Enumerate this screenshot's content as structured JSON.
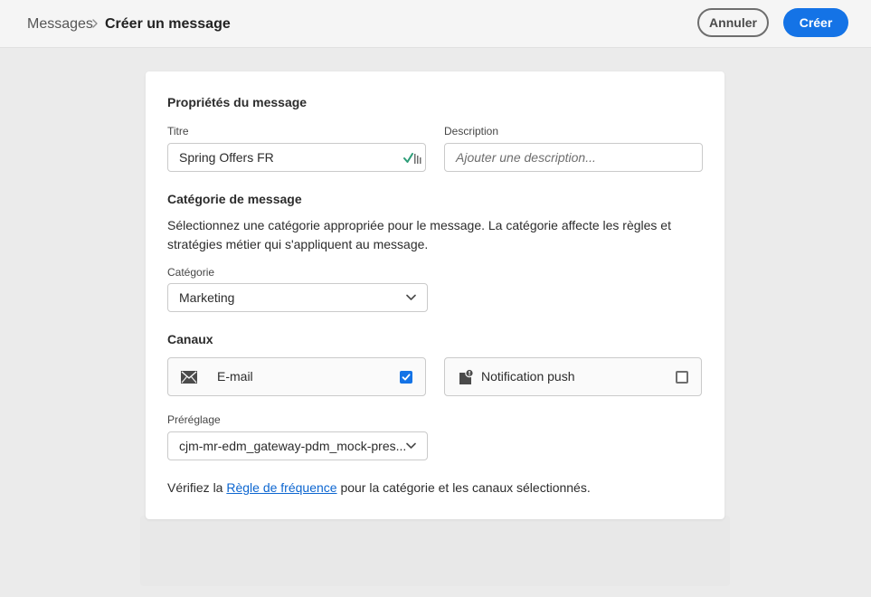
{
  "header": {
    "breadcrumb_root": "Messages",
    "breadcrumb_current": "Créer un message",
    "cancel_label": "Annuler",
    "create_label": "Créer"
  },
  "properties": {
    "section_title": "Propriétés du message",
    "title_label": "Titre",
    "title_value": "Spring Offers FR",
    "description_label": "Description",
    "description_placeholder": "Ajouter une description..."
  },
  "category": {
    "section_title": "Catégorie de message",
    "help_text": "Sélectionnez une catégorie appropriée pour le message. La catégorie affecte les règles et stratégies métier qui s'appliquent au message.",
    "field_label": "Catégorie",
    "selected": "Marketing"
  },
  "channels": {
    "section_title": "Canaux",
    "items": [
      {
        "label": "E-mail",
        "icon": "mail-icon",
        "checked": true
      },
      {
        "label": "Notification push",
        "icon": "push-notification-icon",
        "checked": false
      }
    ]
  },
  "preset": {
    "field_label": "Préréglage",
    "selected": "cjm-mr-edm_gateway-pdm_mock-pres..."
  },
  "footer": {
    "prefix": "Vérifiez la",
    "link_text": "Règle de fréquence",
    "suffix": "pour la catégorie et les canaux sélectionnés."
  },
  "colors": {
    "accent": "#1473e6",
    "link": "#0d66d0",
    "validation": "#2d9d78"
  }
}
